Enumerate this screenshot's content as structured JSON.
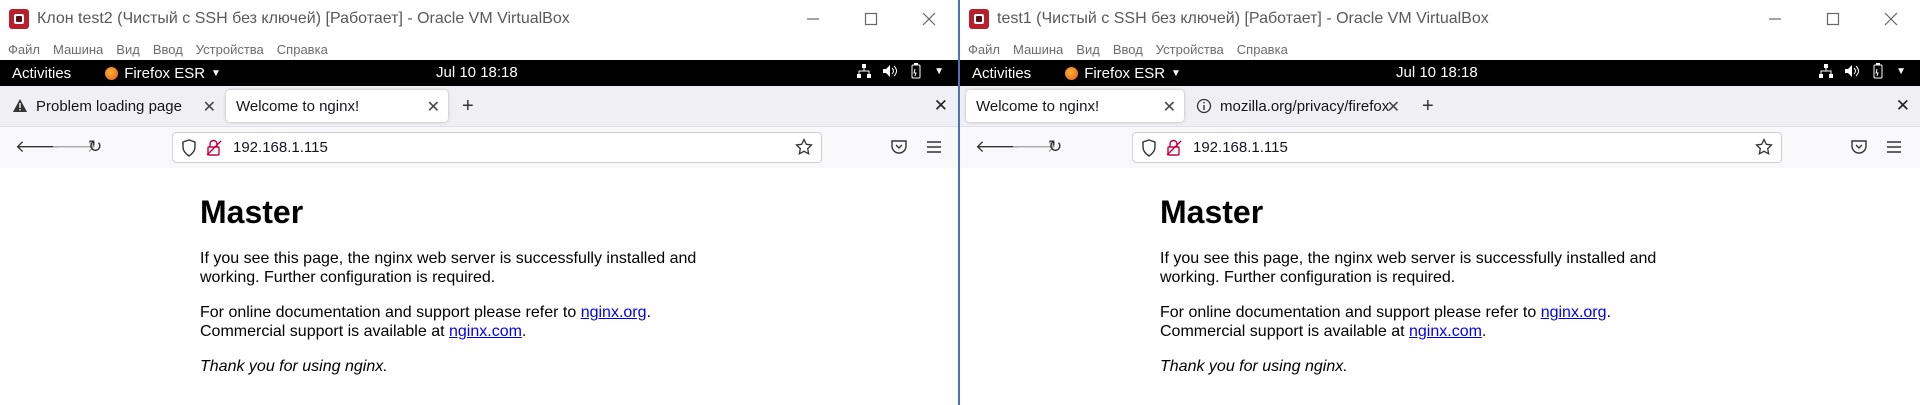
{
  "vms": [
    {
      "window_title": "Клон test2 (Чистый с SSH без ключей) [Работает] - Oracle VM VirtualBox",
      "menu": [
        "Файл",
        "Машина",
        "Вид",
        "Ввод",
        "Устройства",
        "Справка"
      ],
      "gnome": {
        "activities": "Activities",
        "app": "Firefox ESR",
        "clock": "Jul 10  18:18"
      },
      "tabs": [
        {
          "label": "Problem loading page",
          "icon": "warning-icon",
          "active": false
        },
        {
          "label": "Welcome to nginx!",
          "icon": "",
          "active": true
        }
      ],
      "url": "192.168.1.115",
      "page": {
        "heading": "Master",
        "p1": "If you see this page, the nginx web server is successfully installed and working. Further configuration is required.",
        "p2_prefix": "For online documentation and support please refer to ",
        "p2_link": "nginx.org",
        "p2_mid": ".",
        "p2_line2": "Commercial support is available at ",
        "p2_link2": "nginx.com",
        "p2_end": ".",
        "p3": "Thank you for using nginx."
      }
    },
    {
      "window_title": "test1 (Чистый с SSH без ключей) [Работает] - Oracle VM VirtualBox",
      "menu": [
        "Файл",
        "Машина",
        "Вид",
        "Ввод",
        "Устройства",
        "Справка"
      ],
      "gnome": {
        "activities": "Activities",
        "app": "Firefox ESR",
        "clock": "Jul 10  18:18"
      },
      "tabs": [
        {
          "label": "Welcome to nginx!",
          "icon": "",
          "active": true
        },
        {
          "label": "mozilla.org/privacy/firefox",
          "icon": "info-icon",
          "active": false
        }
      ],
      "url": "192.168.1.115",
      "page": {
        "heading": "Master",
        "p1": "If you see this page, the nginx web server is successfully installed and working. Further configuration is required.",
        "p2_prefix": "For online documentation and support please refer to ",
        "p2_link": "nginx.org",
        "p2_mid": ".",
        "p2_line2": "Commercial support is available at ",
        "p2_link2": "nginx.com",
        "p2_end": ".",
        "p3": "Thank you for using nginx."
      }
    }
  ],
  "colors": {
    "gnome_bar": "#000000",
    "tab_bar": "#f0f0f4",
    "link": "#0000ee",
    "divider": "#4a74b8",
    "vbox_icon": "#b81f2b"
  }
}
